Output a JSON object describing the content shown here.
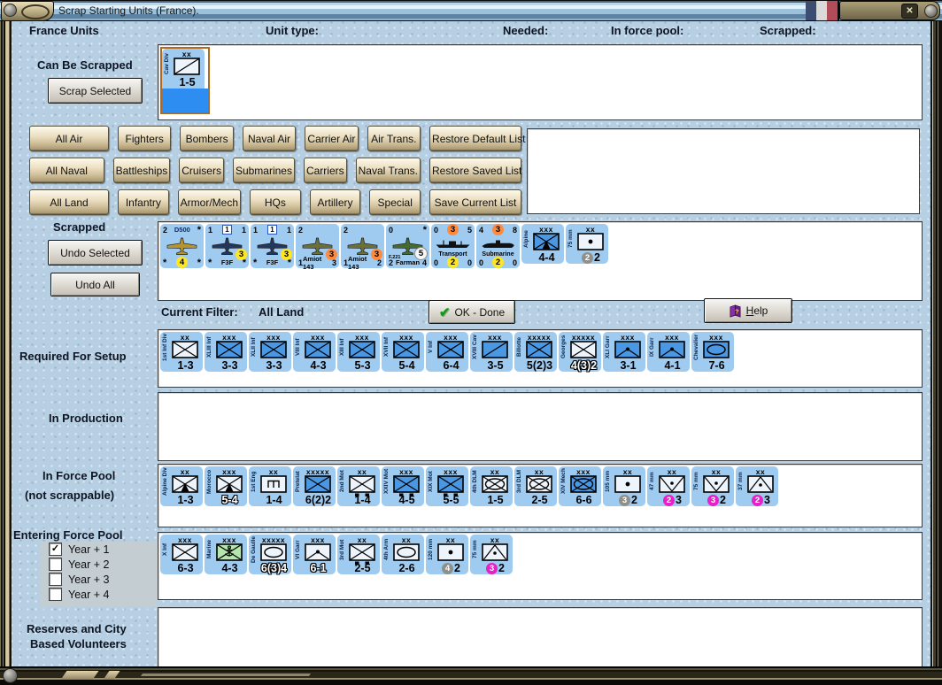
{
  "window": {
    "title": "Scrap Starting Units (France).",
    "close_label": "✕"
  },
  "header": {
    "france_units": "France Units",
    "unit_type": "Unit type:",
    "needed": "Needed:",
    "in_force_pool": "In force pool:",
    "scrapped": "Scrapped:"
  },
  "can_be_scrapped": {
    "label": "Can Be Scrapped",
    "scrap_button": "Scrap Selected"
  },
  "scrapped_section": {
    "label": "Scrapped",
    "undo_selected_button": "Undo Selected",
    "undo_all_button": "Undo All"
  },
  "filter_bar": {
    "label": "Current Filter:",
    "value": "All Land",
    "ok_button": "OK - Done",
    "help_button": "Help"
  },
  "section_labels": {
    "required": "Required For Setup",
    "in_production": "In Production",
    "force_pool_1": "In Force Pool",
    "force_pool_2": "(not scrappable)",
    "entering": "Entering Force Pool",
    "reserves_1": "Reserves and City",
    "reserves_2": "Based Volunteers"
  },
  "entering_checkboxes": [
    {
      "label": "Year + 1",
      "checked": true
    },
    {
      "label": "Year + 2",
      "checked": false
    },
    {
      "label": "Year + 3",
      "checked": false
    },
    {
      "label": "Year + 4",
      "checked": false
    }
  ],
  "filter_buttons": {
    "rows": [
      [
        "All Air",
        "Fighters",
        "Bombers",
        "Naval Air",
        "Carrier Air",
        "Air Trans.",
        "Restore Default List"
      ],
      [
        "All Naval",
        "Battleships",
        "Cruisers",
        "Submarines",
        "Carriers",
        "Naval Trans.",
        "Restore Saved List"
      ],
      [
        "All Land",
        "Infantry",
        "Armor/Mech",
        "HQs",
        "Artillery",
        "Special",
        "Save Current List"
      ]
    ]
  },
  "colors": {
    "counter_bg": "#9fcbf1",
    "symbol_blue": "#4a97e3",
    "symbol_white": "#eef4fb",
    "symbol_green": "#b5e6ad",
    "selection_fill": "#2e8df0",
    "selection_border": "#b06a20",
    "badge_yellow": "#ffe61e",
    "badge_orange": "#ff8a3d",
    "badge_white": "#f6f6f6",
    "badge_gray": "#90908a",
    "badge_magenta": "#e820c8"
  },
  "units": {
    "can_be_scrapped": [
      {
        "kind": "land",
        "vlabel": "Cav Div",
        "size": "xx",
        "sym": "cav",
        "fill": "white",
        "bottom": "1-5",
        "selected": true
      }
    ],
    "scrapped": [
      {
        "kind": "air",
        "tl": "2",
        "tc": "D500",
        "tc_style": "name",
        "tr": "*",
        "plane": "#b5952f",
        "badge": {
          "c": "#ffe61e",
          "tc": "#000",
          "v": "4"
        },
        "badge_slot": "bottom",
        "bl": "*",
        "bc_text": "",
        "br": "*"
      },
      {
        "kind": "air",
        "tl": "1",
        "tc": "1",
        "tc_style": "boxed",
        "tr": "1",
        "plane": "#24365c",
        "badge": {
          "c": "#ffe61e",
          "tc": "#000",
          "v": "3"
        },
        "badge_slot": "mid",
        "bl": "*",
        "bc_text": "F3F",
        "br": "*"
      },
      {
        "kind": "air",
        "tl": "1",
        "tc": "1",
        "tc_style": "boxed",
        "tr": "1",
        "plane": "#24365c",
        "badge": {
          "c": "#ffe61e",
          "tc": "#000",
          "v": "3"
        },
        "badge_slot": "mid",
        "bl": "*",
        "bc_text": "F3F",
        "br": "*"
      },
      {
        "kind": "air",
        "tl": "2",
        "tc": "",
        "tc_style": "name",
        "tr": "",
        "plane": "#6b7038",
        "badge": {
          "c": "#ff8a3d",
          "tc": "#000",
          "v": "3"
        },
        "badge_slot": "mid",
        "bl": "1",
        "bc_text": "Amiot 143",
        "br": "3"
      },
      {
        "kind": "air",
        "tl": "2",
        "tc": "",
        "tc_style": "name",
        "tr": "",
        "plane": "#6b7038",
        "badge": {
          "c": "#ff8a3d",
          "tc": "#000",
          "v": "3"
        },
        "badge_slot": "mid",
        "bl": "1",
        "bc_text": "Amiot 143",
        "br": "2"
      },
      {
        "kind": "air",
        "tl": "0",
        "tc": "",
        "tc_style": "name",
        "tr": "*",
        "plane": "#456b2f",
        "badge": {
          "c": "#f6f6f6",
          "tc": "#000",
          "v": "5",
          "border": true
        },
        "badge_slot": "mid",
        "sub": "F.221",
        "bl": "2",
        "bc_text": "Farman",
        "br": "4"
      },
      {
        "kind": "naval",
        "tl": "0",
        "tbadge": {
          "c": "#ff8a3d",
          "tc": "#000",
          "v": "3"
        },
        "tr": "5",
        "ship": "transport",
        "name": "Transport",
        "bl": "0",
        "bbadge": {
          "c": "#ffe61e",
          "tc": "#000",
          "v": "2"
        },
        "br": "0"
      },
      {
        "kind": "naval",
        "tl": "4",
        "tbadge": {
          "c": "#ff8a3d",
          "tc": "#000",
          "v": "3"
        },
        "tr": "8",
        "ship": "submarine",
        "name": "Submarine",
        "bl": "0",
        "bbadge": {
          "c": "#ffe61e",
          "tc": "#000",
          "v": "2"
        },
        "br": "0"
      },
      {
        "kind": "land",
        "vlabel": "Alpine",
        "size": "xxx",
        "sym": "mtn",
        "fill": "blue",
        "bottom": "4-4"
      },
      {
        "kind": "land",
        "vlabel": "75 mm",
        "size": "xx",
        "sym": "art",
        "fill": "white",
        "pair": {
          "c": "#90908a",
          "tc": "#fff",
          "cv": "2",
          "v": "2"
        }
      }
    ],
    "required": [
      {
        "kind": "land",
        "vlabel": "1st Inf Div",
        "size": "xx",
        "sym": "inf",
        "fill": "white",
        "bottom": "1-3"
      },
      {
        "kind": "land",
        "vlabel": "XLIII Inf",
        "size": "xxx",
        "sym": "inf",
        "fill": "blue",
        "bottom": "3-3"
      },
      {
        "kind": "land",
        "vlabel": "XLII Inf",
        "size": "xxx",
        "sym": "inf",
        "fill": "blue",
        "bottom": "3-3"
      },
      {
        "kind": "land",
        "vlabel": "VIII Inf",
        "size": "xxx",
        "sym": "inf",
        "fill": "blue",
        "bottom": "4-3"
      },
      {
        "kind": "land",
        "vlabel": "XIII Inf",
        "size": "xxx",
        "sym": "inf",
        "fill": "blue",
        "bottom": "5-3"
      },
      {
        "kind": "land",
        "vlabel": "XVII Inf",
        "size": "xxx",
        "sym": "inf",
        "fill": "blue",
        "bottom": "5-4"
      },
      {
        "kind": "land",
        "vlabel": "V Inf",
        "size": "xxx",
        "sym": "inf",
        "fill": "blue",
        "bottom": "6-4"
      },
      {
        "kind": "land",
        "vlabel": "XVIII Cav",
        "size": "xxx",
        "sym": "cav",
        "fill": "blue",
        "bottom": "3-5"
      },
      {
        "kind": "land",
        "vlabel": "Billotte",
        "size": "xxxxx",
        "sym": "inf",
        "fill": "blue",
        "bottom": "5(2)3"
      },
      {
        "kind": "land",
        "vlabel": "Georges",
        "size": "xxxxx",
        "sym": "inf",
        "fill": "white",
        "bottom": "4(3)2",
        "outline": true
      },
      {
        "kind": "land",
        "vlabel": "XLI Garr",
        "size": "xxx",
        "sym": "garr",
        "fill": "blue",
        "bottom": "3-1"
      },
      {
        "kind": "land",
        "vlabel": "IX Garr",
        "size": "xxx",
        "sym": "garr",
        "fill": "blue",
        "bottom": "4-1"
      },
      {
        "kind": "land",
        "vlabel": "Chevalier",
        "size": "xxx",
        "sym": "arm",
        "fill": "blue",
        "bottom": "7-6"
      }
    ],
    "in_production": [],
    "force_pool": [
      {
        "kind": "land",
        "vlabel": "Alpine Div",
        "size": "xx",
        "sym": "mtn",
        "fill": "white",
        "bottom": "1-3"
      },
      {
        "kind": "land",
        "vlabel": "Morocco",
        "size": "xxx",
        "sym": "mtn",
        "fill": "white",
        "bottom": "5-4",
        "outline": true
      },
      {
        "kind": "land",
        "vlabel": "1st Eng",
        "size": "xx",
        "sym": "eng",
        "fill": "white",
        "bottom": "1-4"
      },
      {
        "kind": "land",
        "vlabel": "Pretelat",
        "size": "xxxxx",
        "sym": "inf",
        "fill": "blue",
        "bottom": "6(2)2"
      },
      {
        "kind": "land",
        "vlabel": "2nd Mot Div",
        "size": "xx",
        "sym": "mot",
        "fill": "white",
        "bottom": "1-4"
      },
      {
        "kind": "land",
        "vlabel": "XXIV Mot",
        "size": "xxx",
        "sym": "mot",
        "fill": "blue",
        "bottom": "4-5"
      },
      {
        "kind": "land",
        "vlabel": "XIX Mot",
        "size": "xxx",
        "sym": "mot",
        "fill": "blue",
        "bottom": "5-5"
      },
      {
        "kind": "land",
        "vlabel": "4th DLM Div",
        "size": "xx",
        "sym": "mech",
        "fill": "white",
        "bottom": "1-5"
      },
      {
        "kind": "land",
        "vlabel": "3rd DLM Div",
        "size": "xx",
        "sym": "mech",
        "fill": "white",
        "bottom": "2-5"
      },
      {
        "kind": "land",
        "vlabel": "XIV Mech",
        "size": "xxx",
        "sym": "mech",
        "fill": "blue",
        "bottom": "6-6"
      },
      {
        "kind": "land",
        "vlabel": "105 mm",
        "size": "xx",
        "sym": "art",
        "fill": "white",
        "pair": {
          "c": "#90908a",
          "tc": "#fff",
          "cv": "3",
          "v": "2"
        }
      },
      {
        "kind": "land",
        "vlabel": "47 mm",
        "size": "xx",
        "sym": "at",
        "fill": "white",
        "pair": {
          "c": "#e820c8",
          "tc": "#fff",
          "cv": "2",
          "v": "3"
        }
      },
      {
        "kind": "land",
        "vlabel": "75 mm",
        "size": "xx",
        "sym": "at",
        "fill": "white",
        "pair": {
          "c": "#e820c8",
          "tc": "#fff",
          "cv": "3",
          "v": "2"
        }
      },
      {
        "kind": "land",
        "vlabel": "37 mm",
        "size": "xx",
        "sym": "aa",
        "fill": "white",
        "pair": {
          "c": "#e820c8",
          "tc": "#fff",
          "cv": "2",
          "v": "3"
        }
      }
    ],
    "entering": [
      {
        "kind": "land",
        "vlabel": "X Inf",
        "size": "xxx",
        "sym": "inf",
        "fill": "white",
        "bottom": "6-3"
      },
      {
        "kind": "land",
        "vlabel": "Marine",
        "size": "xxx",
        "sym": "marine",
        "fill": "green",
        "bottom": "4-3"
      },
      {
        "kind": "land",
        "vlabel": "De Gaulle",
        "size": "xxxxx",
        "sym": "arm",
        "fill": "white",
        "bottom": "6(3)4",
        "outline": true
      },
      {
        "kind": "land",
        "vlabel": "VI Garr",
        "size": "xxx",
        "sym": "garr",
        "fill": "white",
        "bottom": "6-1",
        "outline": true
      },
      {
        "kind": "land",
        "vlabel": "3rd Mot Div",
        "size": "xx",
        "sym": "mot",
        "fill": "white",
        "bottom": "2-5"
      },
      {
        "kind": "land",
        "vlabel": "4th Arm Div",
        "size": "xx",
        "sym": "arm",
        "fill": "white",
        "bottom": "2-6"
      },
      {
        "kind": "land",
        "vlabel": "120 mm",
        "size": "xx",
        "sym": "art",
        "fill": "white",
        "pair": {
          "c": "#90908a",
          "tc": "#fff",
          "cv": "4",
          "v": "2"
        }
      },
      {
        "kind": "land",
        "vlabel": "75 mm",
        "size": "xx",
        "sym": "aa",
        "fill": "white",
        "pair": {
          "c": "#e820c8",
          "tc": "#fff",
          "cv": "3",
          "v": "2"
        }
      }
    ],
    "reserves": []
  }
}
